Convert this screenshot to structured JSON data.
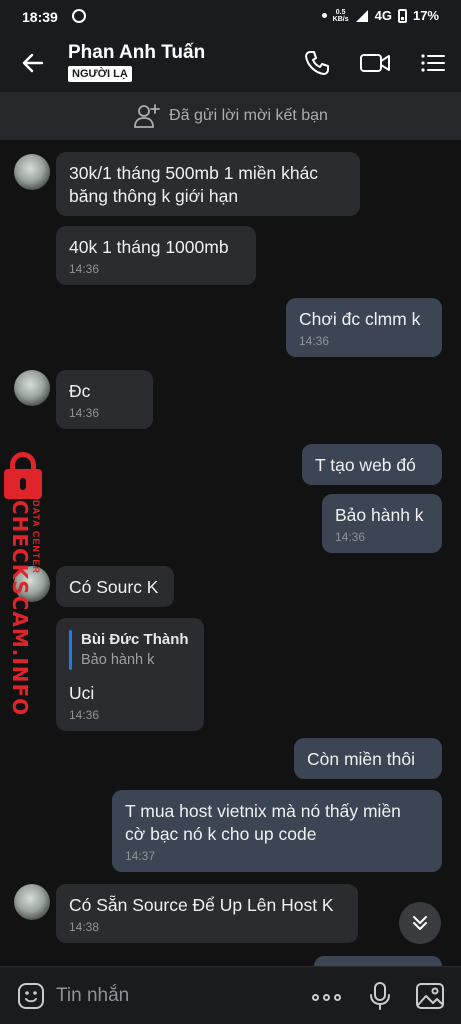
{
  "status_bar": {
    "time": "18:39",
    "speed_value": "0.5",
    "speed_unit": "KB/s",
    "network": "4G",
    "battery": "17%"
  },
  "header": {
    "contact_name": "Phan Anh Tuấn",
    "badge": "NGƯỜI LẠ",
    "icons": [
      "back-arrow-icon",
      "phone-icon",
      "video-call-icon",
      "menu-list-icon"
    ]
  },
  "friend_request_bar": {
    "text": "Đã gửi lời mời kết bạn",
    "icon": "add-person-icon"
  },
  "messages": [
    {
      "side": "in",
      "lines": [
        "30k/1 tháng 500mb 1 miền khác",
        "băng thông k giới hạn"
      ],
      "time": ""
    },
    {
      "side": "in",
      "text": "40k 1 tháng 1000mb",
      "time": "14:36"
    },
    {
      "side": "out",
      "text": "Chơi đc clmm k",
      "time": "14:36"
    },
    {
      "side": "in",
      "text": "Đc",
      "time": "14:36"
    },
    {
      "side": "out",
      "text": "T tạo web đó",
      "time": ""
    },
    {
      "side": "out",
      "text": "Bảo hành k",
      "time": "14:36"
    },
    {
      "side": "in",
      "text": "Có Sourc K",
      "time": ""
    },
    {
      "side": "in",
      "quote_name": "Bùi Đức Thành",
      "quote_text": "Bảo hành k",
      "text": "Uci",
      "time": "14:36"
    },
    {
      "side": "out",
      "text": "Còn miền thôi",
      "time": ""
    },
    {
      "side": "out",
      "lines": [
        "T mua host vietnix mà nó thấy miền",
        "cờ bạc nó k cho up code"
      ],
      "time": "14:37"
    },
    {
      "side": "in",
      "text": "Có Sẵn Source Để Up Lên Host K",
      "time": "14:38"
    }
  ],
  "watermark": {
    "main": "CHECKSCAM.INFO",
    "sub": "DATA CENTER"
  },
  "input_bar": {
    "placeholder": "Tin nhắn",
    "icons": [
      "emoji-icon",
      "more-options-icon",
      "microphone-icon",
      "image-icon"
    ]
  },
  "colors": {
    "background": "#121212",
    "incoming_bubble": "#2b2c2f",
    "outgoing_bubble": "#3b4553",
    "quote_bar": "#1f7be6",
    "watermark": "#e0242b"
  }
}
